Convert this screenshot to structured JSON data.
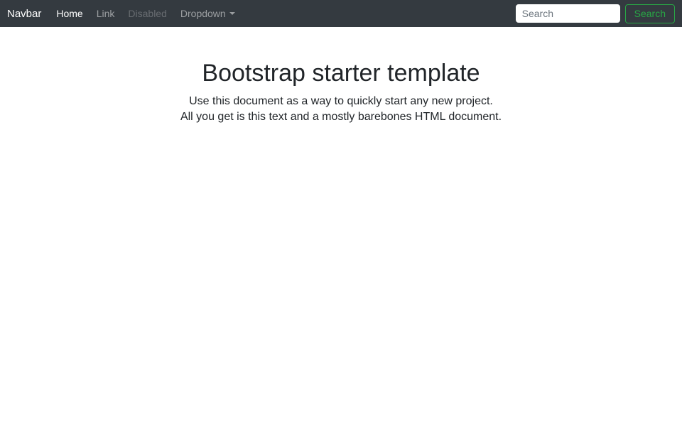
{
  "navbar": {
    "brand": "Navbar",
    "items": [
      {
        "label": "Home",
        "state": "active"
      },
      {
        "label": "Link",
        "state": "default"
      },
      {
        "label": "Disabled",
        "state": "disabled"
      },
      {
        "label": "Dropdown",
        "state": "dropdown"
      }
    ],
    "search": {
      "placeholder": "Search",
      "button_label": "Search"
    }
  },
  "main": {
    "title": "Bootstrap starter template",
    "lead_line1": "Use this document as a way to quickly start any new project.",
    "lead_line2": "All you get is this text and a mostly barebones HTML document."
  },
  "colors": {
    "navbar_background": "#343a40",
    "navbar_active_link": "#ffffff",
    "navbar_muted_link": "rgba(255,255,255,0.5)",
    "navbar_disabled_link": "rgba(255,255,255,0.25)",
    "success_accent": "#28a745",
    "heading_text": "#212529"
  }
}
